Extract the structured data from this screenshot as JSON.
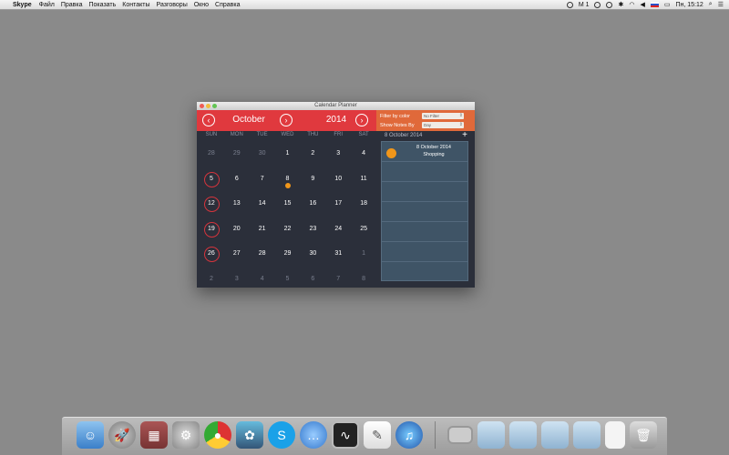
{
  "menubar": {
    "apple": "",
    "app_name": "Skype",
    "items": [
      "Файл",
      "Правка",
      "Показать",
      "Контакты",
      "Разговоры",
      "Окно",
      "Справка"
    ],
    "status_m": "M 1",
    "clock": "Пн, 15:12"
  },
  "window": {
    "title": "Calendar Planner",
    "month": "October",
    "year": "2014",
    "filter_label": "Filter by color",
    "filter_value": "No Filter",
    "show_label": "Show Notes By",
    "show_value": "Day",
    "prev_glyph": "‹",
    "next_glyph": "›",
    "weekdays": [
      "SUN",
      "MON",
      "TUE",
      "WED",
      "THU",
      "FRI",
      "SAT"
    ],
    "weeks": [
      [
        "28",
        "29",
        "30",
        "1",
        "2",
        "3",
        "4"
      ],
      [
        "5",
        "6",
        "7",
        "8",
        "9",
        "10",
        "11"
      ],
      [
        "12",
        "13",
        "14",
        "15",
        "16",
        "17",
        "18"
      ],
      [
        "19",
        "20",
        "21",
        "22",
        "23",
        "24",
        "25"
      ],
      [
        "26",
        "27",
        "28",
        "29",
        "30",
        "31",
        "1"
      ],
      [
        "2",
        "3",
        "4",
        "5",
        "6",
        "7",
        "8"
      ]
    ],
    "selected_date": "8 October 2014",
    "add_glyph": "+",
    "note": {
      "date": "8 October 2014",
      "title": "Shopping",
      "color": "#f0961a"
    }
  },
  "colors": {
    "header_red": "#e0393e",
    "header_orange": "#e0693a",
    "window_bg": "#2b2f3a",
    "notes_panel": "#3f5466",
    "event_dot": "#f0961a"
  },
  "dock": {
    "icons": [
      "finder-icon",
      "launchpad-icon",
      "photo-slideshow-icon",
      "system-preferences-icon",
      "chrome-icon",
      "iphoto-icon",
      "skype-icon",
      "messages-icon",
      "activity-monitor-icon",
      "textedit-icon",
      "itunes-icon",
      "screen-icon",
      "folder-icon",
      "folder-icon",
      "folder-icon",
      "folder-icon",
      "document-icon",
      "trash-icon"
    ]
  }
}
